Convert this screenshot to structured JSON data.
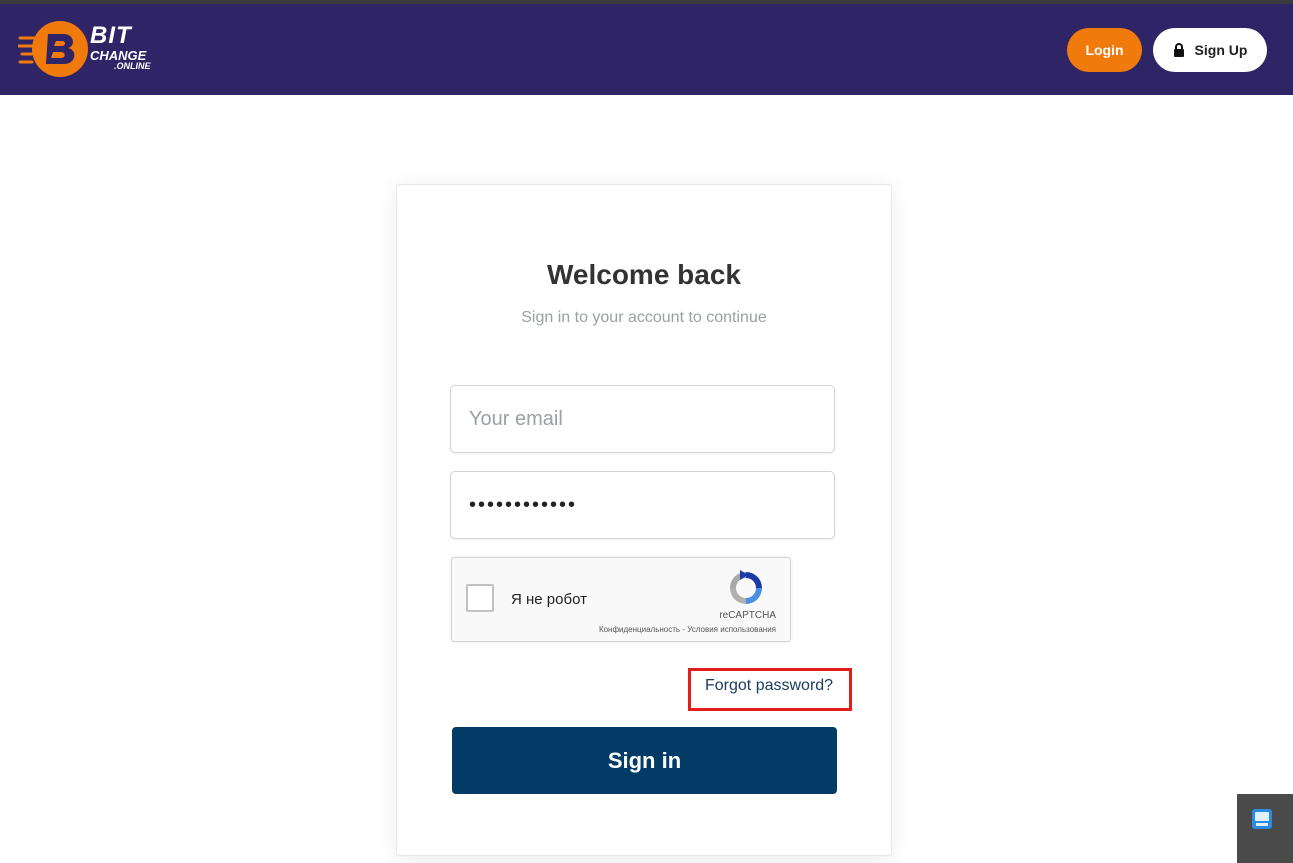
{
  "header": {
    "logo": {
      "line1": "BIT",
      "line2": "CHANGE",
      "line3": ".ONLINE"
    },
    "login_label": "Login",
    "signup_label": "Sign Up",
    "colors": {
      "bar": "#2f2466",
      "login_button": "#f07a0c"
    }
  },
  "card": {
    "title": "Welcome back",
    "subtitle": "Sign in to your account to continue",
    "email": {
      "placeholder": "Your email",
      "value": ""
    },
    "password": {
      "value": "••••••••••••"
    },
    "captcha": {
      "label": "Я не робот",
      "brand": "reCAPTCHA",
      "links": "Конфиденциальность - Условия использования"
    },
    "forgot_label": "Forgot password?",
    "signin_label": "Sign in",
    "colors": {
      "signin_button": "#023b66",
      "highlight": "#e11d1d"
    }
  },
  "icons": {
    "logo": "bitchange-b-logo-icon",
    "signup": "lock-icon",
    "captcha": "recaptcha-logo-icon",
    "widget": "tray-app-icon"
  }
}
